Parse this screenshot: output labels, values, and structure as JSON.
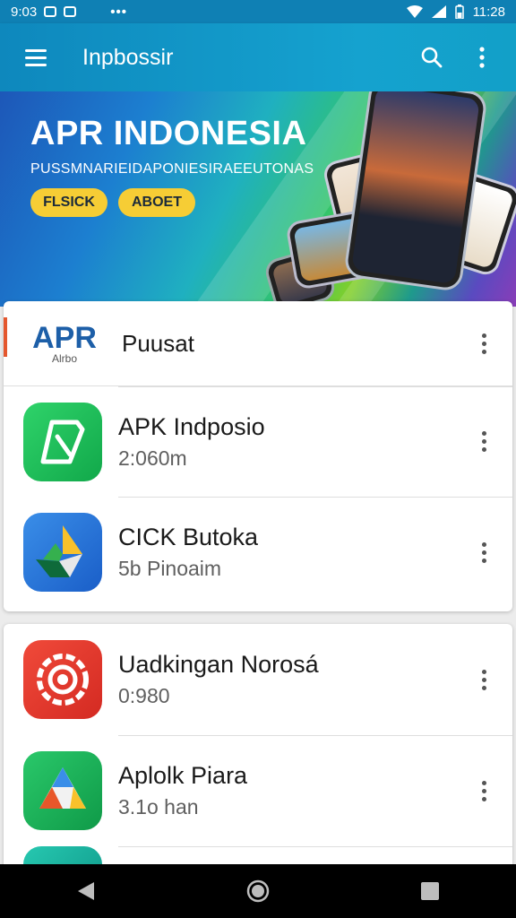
{
  "status_bar": {
    "time_left": "9:03",
    "time_right": "11:28"
  },
  "app_bar": {
    "title": "Inpbossir"
  },
  "banner": {
    "title": "APR INDONESIA",
    "subtitle": "PUSSMNARIEIDAPONIESIRAEEUTONAS",
    "buttons": [
      "FLSICK",
      "ABOET"
    ]
  },
  "header_item": {
    "logo_text": "APR",
    "logo_subtext": "Alrbo",
    "label": "Puusat"
  },
  "apps_card1": [
    {
      "name": "APK Indposio",
      "meta": "2:060m"
    },
    {
      "name": "CICK Butoka",
      "meta": "5b Pinoaim"
    }
  ],
  "apps_card2": [
    {
      "name": "Uadkingan Norosá",
      "meta": "0:980"
    },
    {
      "name": "Aplolk Piara",
      "meta": "3.1o han"
    }
  ],
  "colors": {
    "appbar": "#0e88bd",
    "accent_yellow": "#f6cd35"
  }
}
